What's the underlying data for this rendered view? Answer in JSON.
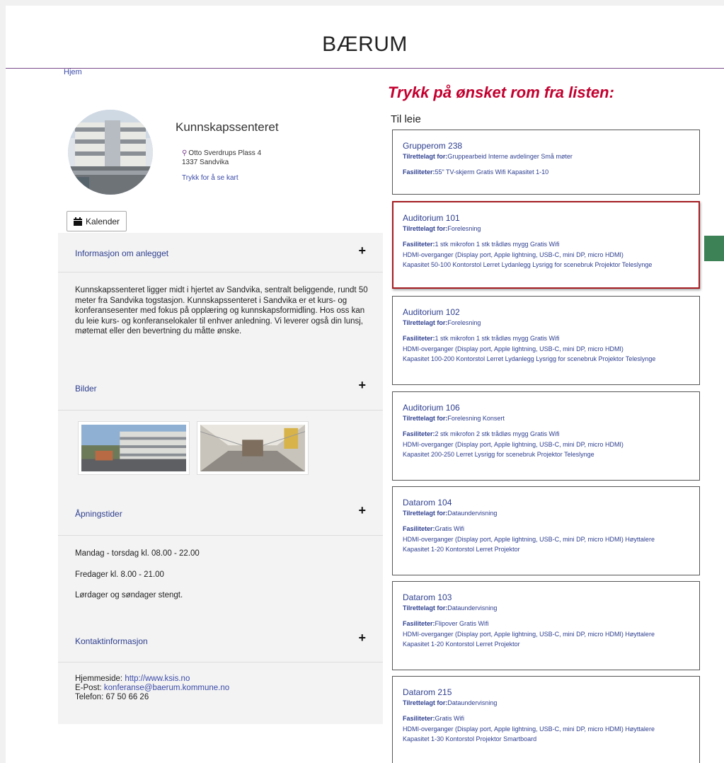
{
  "header": {
    "title": "BÆRUM",
    "home_link": "Hjem"
  },
  "venue": {
    "name": "Kunnskapssenteret",
    "address_line1": "Otto Sverdrups Plass 4",
    "address_line2": "1337  Sandvika",
    "map_link": "Trykk for å se kart",
    "calendar_button": "Kalender"
  },
  "sections": {
    "info": {
      "title": "Informasjon om anlegget",
      "text": "Kunnskapssenteret ligger midt i hjertet av Sandvika,  sentralt beliggende, rundt 50 meter fra Sandvika togstasjon. Kunnskapssenteret i Sandvika er et kurs- og konferansesenter med fokus på opplæring og kunnskapsformidling.  Hos oss kan du leie kurs- og konferanselokaler til enhver anledning.  Vi leverer også din lunsj, møtemat eller den bevertning du måtte ønske."
    },
    "images": {
      "title": "Bilder"
    },
    "hours": {
      "title": "Åpningstider",
      "lines": [
        "Mandag - torsdag kl. 08.00 - 22.00",
        "Fredager kl. 8.00 - 21.00",
        "Lørdager og søndager stengt."
      ]
    },
    "contact": {
      "title": "Kontaktinformasjon",
      "web_label": "Hjemmeside: ",
      "web_value": "http://www.ksis.no",
      "email_label": "E-Post: ",
      "email_value": "konferanse@baerum.kommune.no",
      "phone": "Telefon: 67 50 66 26"
    },
    "plus_symbol": "+"
  },
  "rooms_panel": {
    "instruction": "Trykk på ønsket rom fra listen:",
    "heading": "Til leie",
    "adapted_label": "Tilrettelagt for:",
    "facilities_label": "Fasiliteter:",
    "rooms": [
      {
        "name": "Grupperom 238",
        "adapted": "Gruppearbeid    Interne avdelinger    Små møter",
        "fac1": "55\" TV-skjerm Gratis Wifi Kapasitet 1-10",
        "fac2": "",
        "fac3": ""
      },
      {
        "name": "Auditorium 101",
        "adapted": "Forelesning",
        "fac1": "1 stk mikrofon 1 stk trådløs mygg Gratis Wifi",
        "fac2": "HDMI-overganger (Display port, Apple lightning, USB-C, mini DP, micro HDMI)",
        "fac3": "Kapasitet 50-100 Kontorstol Lerret Lydanlegg Lysrigg for scenebruk Projektor Teleslynge"
      },
      {
        "name": "Auditorium 102",
        "adapted": "Forelesning",
        "fac1": "1 stk mikrofon 1 stk trådløs mygg Gratis Wifi",
        "fac2": "HDMI-overganger (Display port, Apple lightning, USB-C, mini DP, micro HDMI)",
        "fac3": "Kapasitet 100-200 Kontorstol Lerret Lydanlegg Lysrigg for scenebruk Projektor Teleslynge"
      },
      {
        "name": "Auditorium 106",
        "adapted": "Forelesning    Konsert",
        "fac1": "2 stk mikrofon 2 stk trådløs mygg Gratis Wifi",
        "fac2": "HDMI-overganger (Display port, Apple lightning, USB-C, mini DP, micro HDMI)",
        "fac3": "Kapasitet 200-250 Lerret Lysrigg for scenebruk Projektor Teleslynge"
      },
      {
        "name": "Datarom 104",
        "adapted": "Dataundervisning",
        "fac1": "Gratis Wifi",
        "fac2": "HDMI-overganger (Display port, Apple lightning, USB-C, mini DP, micro HDMI) Høyttalere",
        "fac3": "Kapasitet 1-20 Kontorstol Lerret Projektor"
      },
      {
        "name": "Datarom 103",
        "adapted": "Dataundervisning",
        "fac1": "Flipover Gratis Wifi",
        "fac2": "HDMI-overganger (Display port, Apple lightning, USB-C, mini DP, micro HDMI) Høyttalere",
        "fac3": "Kapasitet 1-20 Kontorstol Lerret Projektor"
      },
      {
        "name": "Datarom 215",
        "adapted": "Dataundervisning",
        "fac1": "Gratis Wifi",
        "fac2": "HDMI-overganger (Display port, Apple lightning, USB-C, mini DP, micro HDMI) Høyttalere",
        "fac3": "Kapasitet 1-30 Kontorstol Projektor Smartboard"
      }
    ]
  }
}
